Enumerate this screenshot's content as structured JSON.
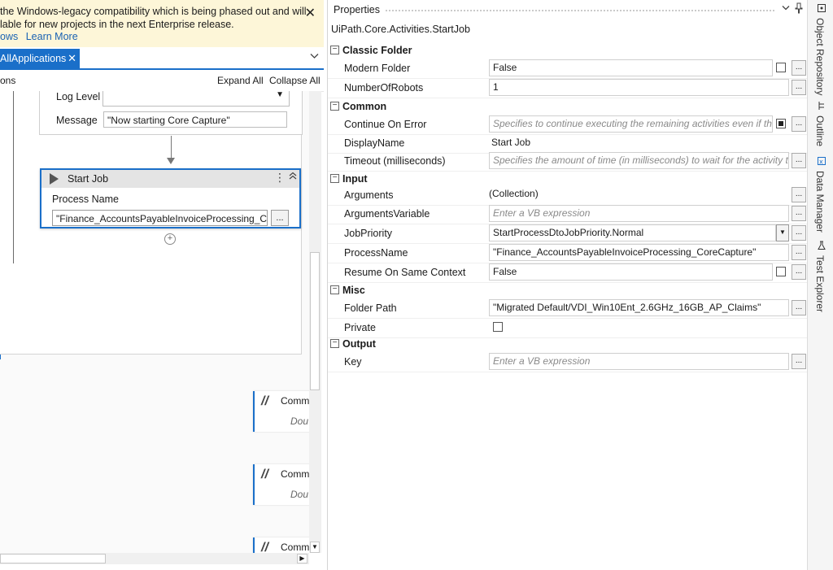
{
  "banner": {
    "line1": "the Windows-legacy compatibility which is being phased out and will",
    "line2": "lable for new projects in the next Enterprise release.",
    "link1": "ows",
    "link2": "Learn More",
    "close": "✕"
  },
  "doc_tab": {
    "label": "AllApplications",
    "close": "✕",
    "chevron": "⌄"
  },
  "toolbar": {
    "left_label": "ons",
    "expand_all": "Expand All",
    "collapse_all": "Collapse All"
  },
  "log_activity": {
    "log_level_label": "Log Level",
    "log_level_value": "",
    "message_label": "Message",
    "message_value": "\"Now starting Core Capture\""
  },
  "start_job": {
    "title": "Start Job",
    "process_name_label": "Process Name",
    "process_name_value": "\"Finance_AccountsPayableInvoiceProcessing_CoreC",
    "browse": "..."
  },
  "comments": [
    {
      "title": "Comm",
      "body": "Dou"
    },
    {
      "title": "Comm",
      "body": "Dou"
    },
    {
      "title": "Comm",
      "body": ""
    }
  ],
  "properties": {
    "title": "Properties",
    "type_name": "UiPath.Core.Activities.StartJob",
    "categories": {
      "classic_folder": "Classic Folder",
      "common": "Common",
      "input": "Input",
      "misc": "Misc",
      "output": "Output"
    },
    "rows": {
      "modern_folder": {
        "name": "Modern Folder",
        "value": "False",
        "checked": false
      },
      "number_of_robots": {
        "name": "NumberOfRobots",
        "value": "1"
      },
      "continue_on_error": {
        "name": "Continue On Error",
        "placeholder": "Specifies to continue executing the remaining activities even if the cu",
        "checked": true
      },
      "display_name": {
        "name": "DisplayName",
        "value": "Start Job"
      },
      "timeout": {
        "name": "Timeout (milliseconds)",
        "placeholder": "Specifies the amount of time (in milliseconds) to wait for the activity to r"
      },
      "arguments": {
        "name": "Arguments",
        "value": "(Collection)"
      },
      "arguments_variable": {
        "name": "ArgumentsVariable",
        "placeholder": "Enter a VB expression"
      },
      "job_priority": {
        "name": "JobPriority",
        "value": "StartProcessDtoJobPriority.Normal"
      },
      "process_name": {
        "name": "ProcessName",
        "value": "\"Finance_AccountsPayableInvoiceProcessing_CoreCapture\""
      },
      "resume_same_context": {
        "name": "Resume On Same Context",
        "value": "False",
        "checked": false
      },
      "folder_path": {
        "name": "Folder Path",
        "value": "\"Migrated Default/VDI_Win10Ent_2.6GHz_16GB_AP_Claims\""
      },
      "private": {
        "name": "Private",
        "checked": false
      },
      "key": {
        "name": "Key",
        "placeholder": "Enter a VB expression"
      }
    },
    "browse": "..."
  },
  "side_strip": {
    "tabs": [
      {
        "label": "Object Repository",
        "icon": "object-repository-icon"
      },
      {
        "label": "Outline",
        "icon": "outline-icon"
      },
      {
        "label": "Data Manager",
        "icon": "data-manager-icon"
      },
      {
        "label": "Test Explorer",
        "icon": "test-explorer-icon"
      }
    ]
  },
  "colors": {
    "accent": "#1a6fc9",
    "banner_bg": "#fdf6d8",
    "link": "#1a62b3"
  }
}
